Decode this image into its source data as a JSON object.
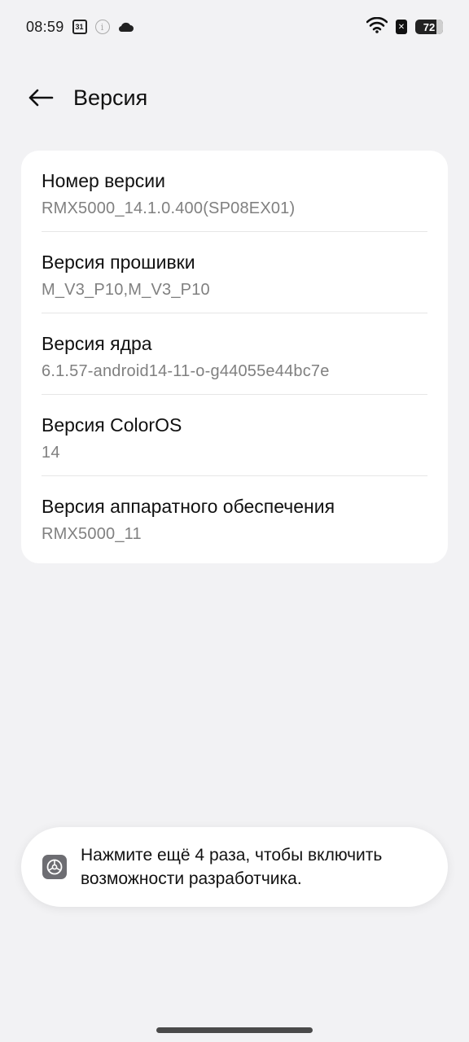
{
  "status_bar": {
    "time": "08:59",
    "calendar_day": "31",
    "battery_level": "72",
    "icons": [
      "calendar-icon",
      "info-icon",
      "cloud-icon",
      "wifi-icon",
      "sim-x-icon",
      "battery-icon"
    ]
  },
  "header": {
    "back_icon": "arrow-left-icon",
    "title": "Версия"
  },
  "version_list": {
    "items": [
      {
        "title": "Номер версии",
        "value": "RMX5000_14.1.0.400(SP08EX01)"
      },
      {
        "title": "Версия прошивки",
        "value": "M_V3_P10,M_V3_P10"
      },
      {
        "title": "Версия ядра",
        "value": "6.1.57-android14-11-o-g44055e44bc7e"
      },
      {
        "title": "Версия ColorOS",
        "value": "14"
      },
      {
        "title": "Версия аппаратного обеспечения",
        "value": "RMX5000_11"
      }
    ]
  },
  "toast": {
    "icon": "settings-gear-icon",
    "line1": "Нажмите ещё 4 раза, чтобы включить",
    "line2": "возможности разработчика."
  },
  "colors": {
    "background": "#f2f2f4",
    "card": "#ffffff",
    "secondary_text": "#808080"
  }
}
